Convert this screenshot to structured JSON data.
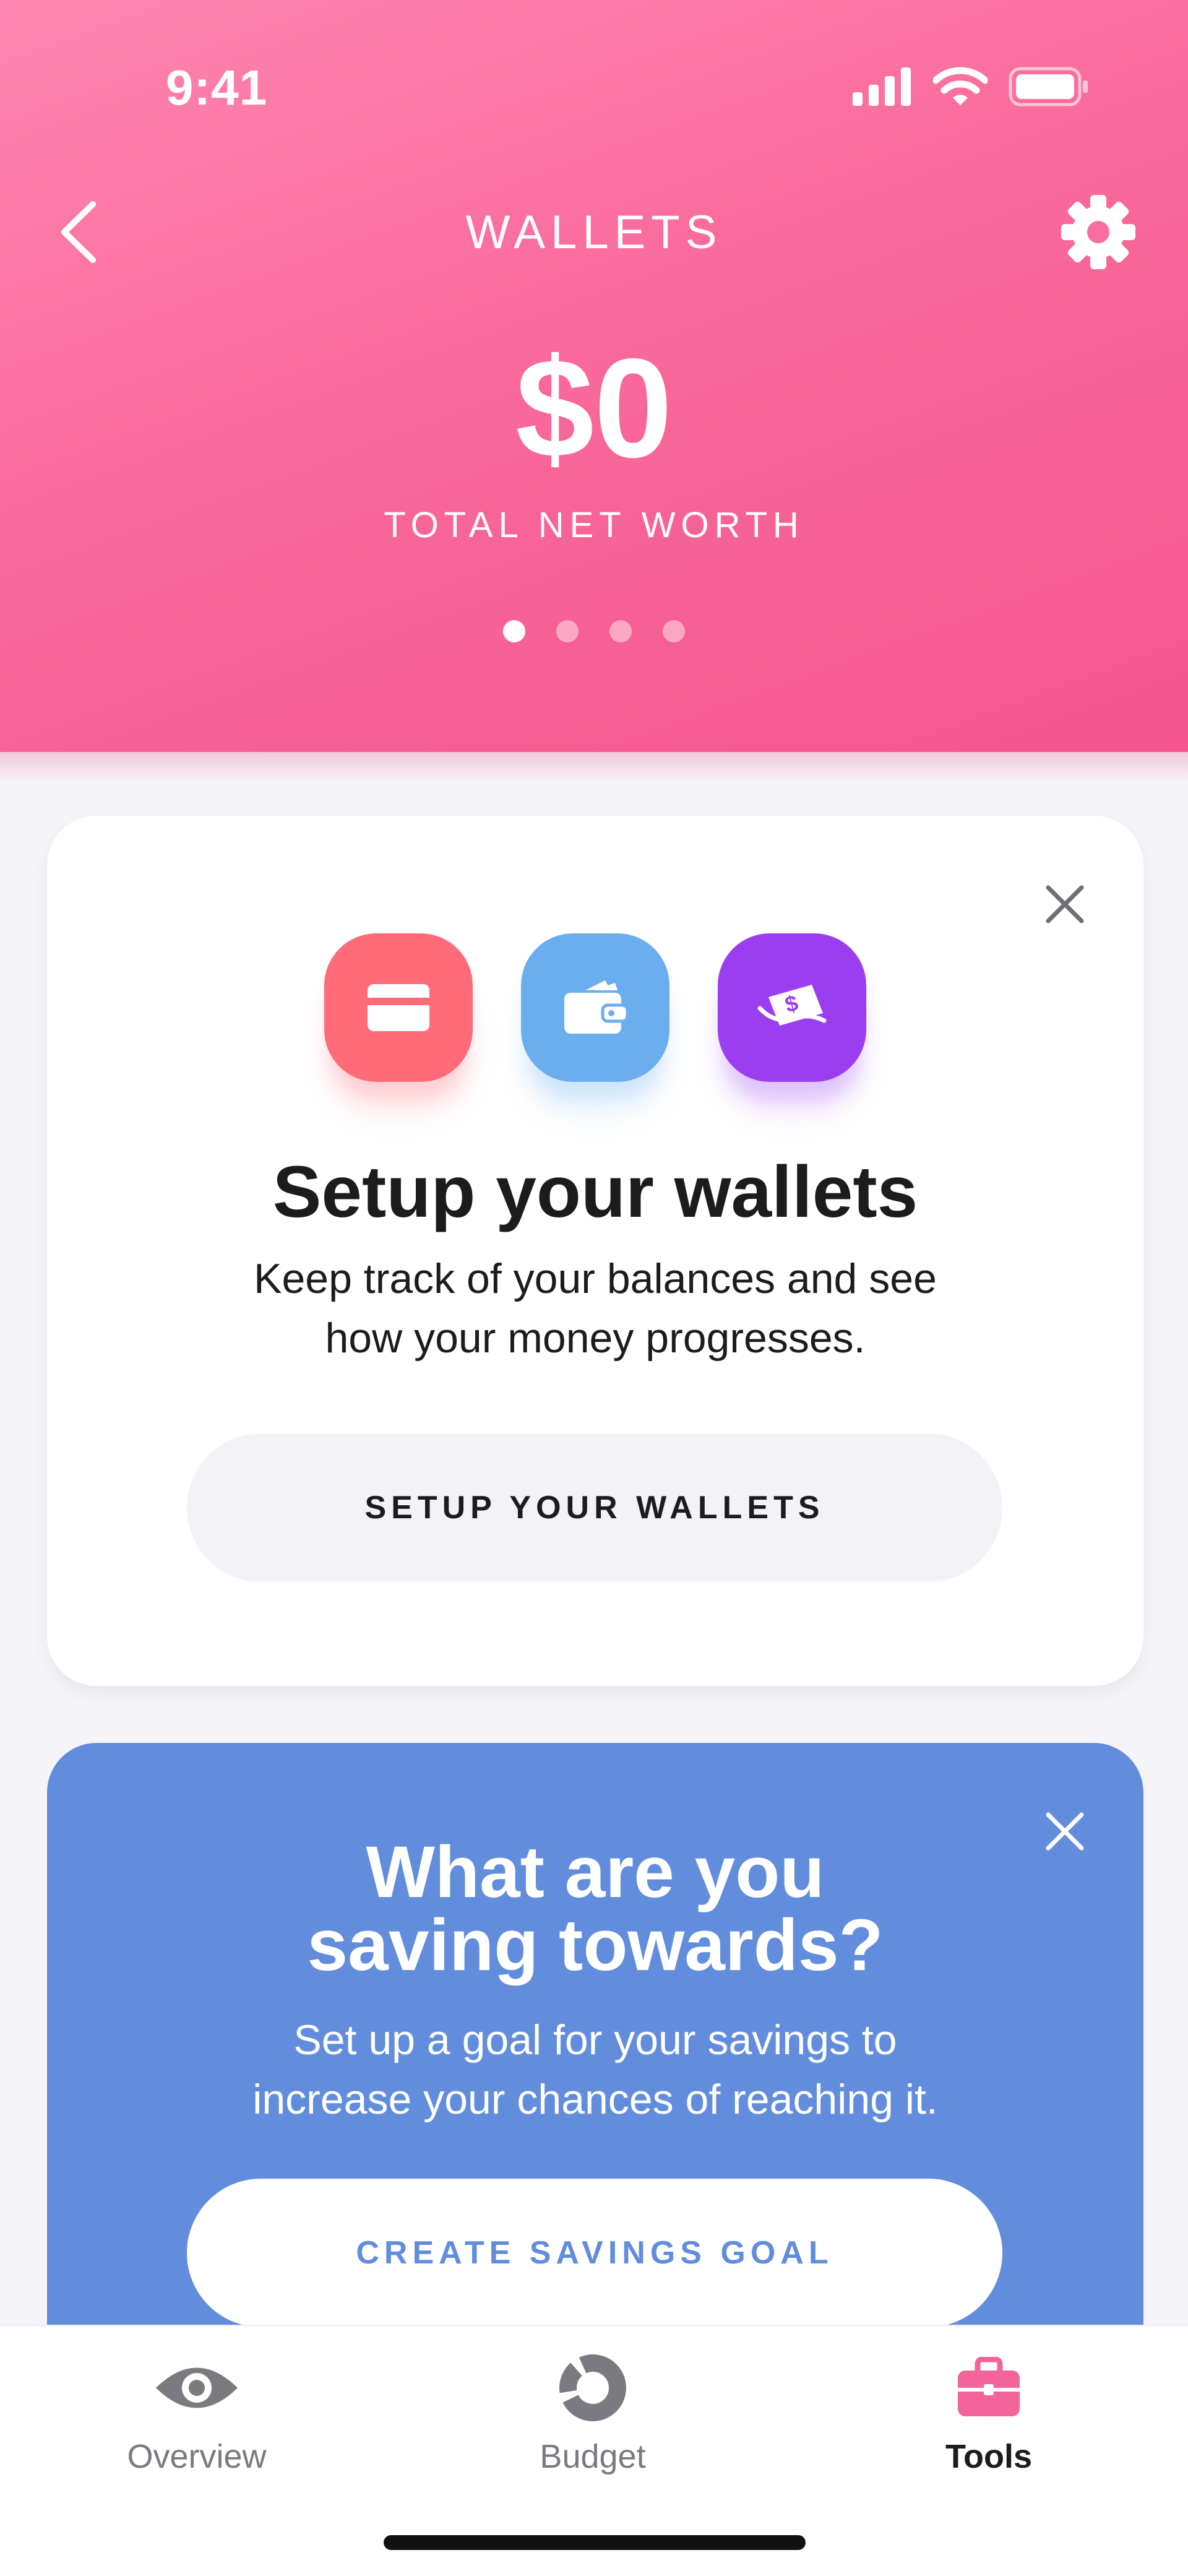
{
  "status_bar": {
    "time": "9:41"
  },
  "header": {
    "title": "WALLETS",
    "net_worth": "$0",
    "net_worth_label": "TOTAL NET WORTH",
    "pages": 4,
    "active_page": 1,
    "gradient": [
      "#FF86B0",
      "#F4568D"
    ]
  },
  "setup_card": {
    "icons": [
      "credit-card-icon",
      "wallet-icon",
      "money-icon"
    ],
    "title": "Setup your wallets",
    "body_line1": "Keep track of your balances and see",
    "body_line2": "how your money progresses.",
    "button_label": "SETUP YOUR WALLETS"
  },
  "savings_card": {
    "title_line1": "What are you",
    "title_line2": "saving towards?",
    "body_line1": "Set up a goal for your savings to",
    "body_line2": "increase your chances of reaching it.",
    "button_label": "CREATE SAVINGS GOAL",
    "background": "#628DDC"
  },
  "tabbar": {
    "tabs": [
      {
        "label": "Overview",
        "icon": "eye-icon"
      },
      {
        "label": "Budget",
        "icon": "donut-chart-icon"
      },
      {
        "label": "Tools",
        "icon": "briefcase-icon"
      }
    ],
    "active": "Tools",
    "accent": "#F2649A"
  }
}
